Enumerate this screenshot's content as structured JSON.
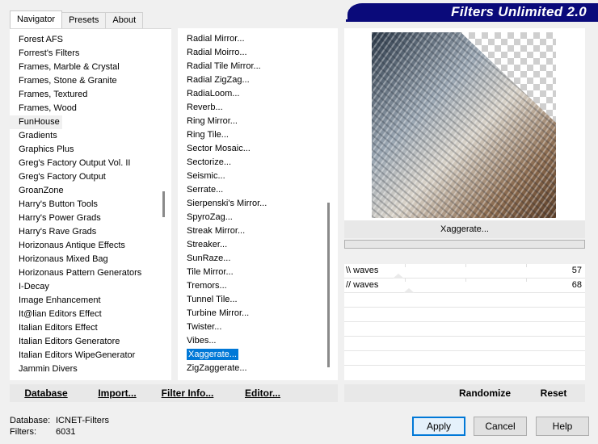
{
  "tabs": [
    "Navigator",
    "Presets",
    "About"
  ],
  "banner": "Filters Unlimited 2.0",
  "categories": [
    "Forest AFS",
    "Forrest's Filters",
    "Frames, Marble & Crystal",
    "Frames, Stone & Granite",
    "Frames, Textured",
    "Frames, Wood",
    "FunHouse",
    "Gradients",
    "Graphics Plus",
    "Greg's Factory Output Vol. II",
    "Greg's Factory Output",
    "GroanZone",
    "Harry's Button Tools",
    "Harry's Power Grads",
    "Harry's Rave Grads",
    "Horizonaus Antique Effects",
    "Horizonaus Mixed Bag",
    "Horizonaus Pattern Generators",
    "I-Decay",
    "Image Enhancement",
    "It@lian Editors Effect",
    "Italian Editors Effect",
    "Italian Editors Generatore",
    "Italian Editors WipeGenerator",
    "Jammin Divers"
  ],
  "selected_category": "FunHouse",
  "filters": [
    "Radial Mirror...",
    "Radial Moirro...",
    "Radial Tile Mirror...",
    "Radial ZigZag...",
    "RadiaLoom...",
    "Reverb...",
    "Ring Mirror...",
    "Ring Tile...",
    "Sector Mosaic...",
    "Sectorize...",
    "Seismic...",
    "Serrate...",
    "Sierpenski's Mirror...",
    "SpyroZag...",
    "Streak Mirror...",
    "Streaker...",
    "SunRaze...",
    "Tile Mirror...",
    "Tremors...",
    "Tunnel Tile...",
    "Turbine Mirror...",
    "Twister...",
    "Vibes...",
    "Xaggerate...",
    "ZigZaggerate..."
  ],
  "selected_filter": "Xaggerate...",
  "left_buttons": {
    "database": "Database",
    "import": "Import...",
    "filter_info": "Filter Info...",
    "editor": "Editor..."
  },
  "right_buttons": {
    "randomize": "Randomize",
    "reset": "Reset"
  },
  "filter_name": "Xaggerate...",
  "params": [
    {
      "label": "\\\\ waves",
      "value": "57",
      "fraction": 0.224
    },
    {
      "label": "// waves",
      "value": "68",
      "fraction": 0.267
    }
  ],
  "status": {
    "database_label": "Database:",
    "database_value": "ICNET-Filters",
    "filters_label": "Filters:",
    "filters_value": "6031"
  },
  "dialog_buttons": {
    "apply": "Apply",
    "cancel": "Cancel",
    "help": "Help"
  }
}
